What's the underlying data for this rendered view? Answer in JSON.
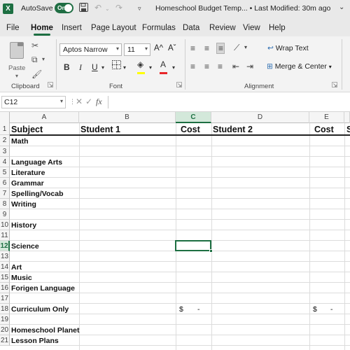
{
  "titlebar": {
    "logo": "X",
    "autosave_label": "AutoSave",
    "autosave_state": "On",
    "doc_title": "Homeschool Budget Temp... • Last Modified: 30m ago",
    "chevron": "⌄"
  },
  "tabs": [
    "File",
    "Home",
    "Insert",
    "Page Layout",
    "Formulas",
    "Data",
    "Review",
    "View",
    "Help"
  ],
  "active_tab": "Home",
  "ribbon": {
    "clipboard": {
      "paste_label": "Paste",
      "group_label": "Clipboard"
    },
    "font": {
      "font_name": "Aptos Narrow",
      "font_size": "11",
      "grow": "A^",
      "shrink": "Aˇ",
      "group_label": "Font"
    },
    "alignment": {
      "wrap_text": "Wrap Text",
      "merge_center": "Merge & Center",
      "group_label": "Alignment"
    }
  },
  "formula_bar": {
    "name_box": "C12",
    "fx": "fx",
    "value": ""
  },
  "columns": [
    "A",
    "B",
    "C",
    "D",
    "E"
  ],
  "selected_column": "C",
  "rows": [
    "1",
    "2",
    "3",
    "4",
    "5",
    "6",
    "7",
    "8",
    "9",
    "10",
    "11",
    "12",
    "13",
    "14",
    "15",
    "16",
    "17",
    "18",
    "19",
    "20",
    "21"
  ],
  "selected_row": "12",
  "header_row": {
    "a": "Subject",
    "b": "Student 1",
    "c": "Cost",
    "d": "Student 2",
    "e": "Cost",
    "f": "S"
  },
  "subjects": {
    "r2": "Math",
    "r4": "Language Arts",
    "r5": "Literature",
    "r6": "Grammar",
    "r7": "Spelling/Vocab",
    "r8": "Writing",
    "r10": "History",
    "r12": "Science",
    "r14": "Art",
    "r15": "Music",
    "r16": "Forigen Language",
    "r18": "Curriculum Only",
    "r20": "Homeschool Planet",
    "r21": "Lesson Plans"
  },
  "curriculum_cost": {
    "c_currency": "$",
    "c_value": "-",
    "e_currency": "$",
    "e_value": "-"
  },
  "colors": {
    "accent": "#1d6f42",
    "header_fill": "#d3e8da"
  }
}
